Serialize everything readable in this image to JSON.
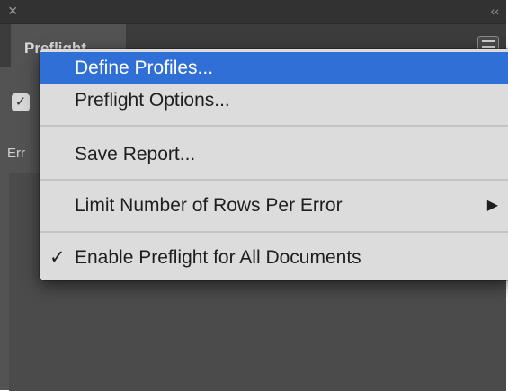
{
  "titlebar": {
    "close_glyph": "×",
    "collapse_glyph": "‹‹"
  },
  "panel": {
    "tab_label": "Preflight",
    "error_label": "Err"
  },
  "menu": {
    "items": [
      {
        "label": "Define Profiles...",
        "highlighted": true
      },
      {
        "label": "Preflight Options..."
      },
      {
        "label": "Save Report..."
      },
      {
        "label": "Limit Number of Rows Per Error",
        "submenu_arrow": "▶"
      },
      {
        "label": "Enable Preflight for All Documents",
        "check": "✓"
      }
    ]
  },
  "colors": {
    "highlight": "#2f6fd6",
    "panel_bg": "#535353",
    "menu_bg": "#dcdcdc"
  }
}
